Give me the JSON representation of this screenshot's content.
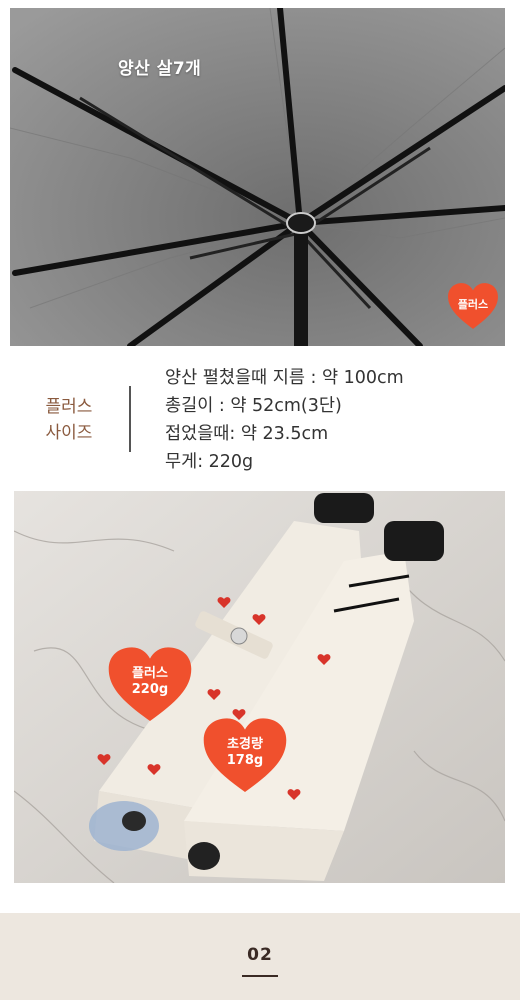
{
  "top_photo": {
    "caption": "양산 살7개",
    "badge": "플러스"
  },
  "spec": {
    "label_line1": "플러스",
    "label_line2": "사이즈",
    "lines": [
      "양산 펼쳤을때 지름 : 약 100cm",
      "총길이 : 약 52cm(3단)",
      "접었을때: 약 23.5cm",
      "무게: 220g"
    ]
  },
  "bottom_photo": {
    "badge_plus": {
      "name": "플러스",
      "weight": "220g"
    },
    "badge_light": {
      "name": "초경량",
      "weight": "178g"
    }
  },
  "footer": {
    "number": "02"
  },
  "colors": {
    "badge": "#f0502d",
    "label": "#8a5a3e",
    "footer_bg": "#ede7df"
  }
}
